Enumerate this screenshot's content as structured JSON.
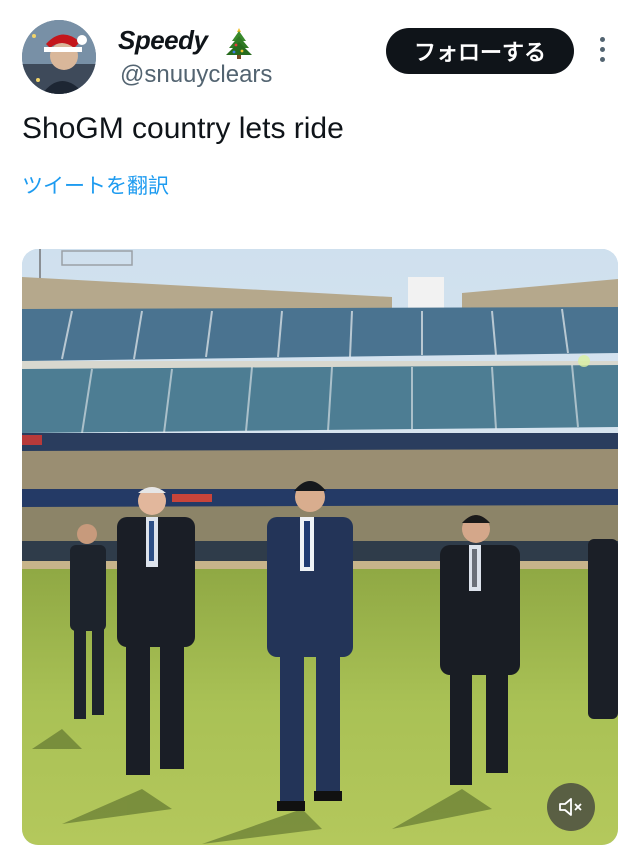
{
  "user": {
    "display_name": "Speedy",
    "display_name_emoji_icon": "christmas-tree-icon",
    "handle": "@snuuyclears",
    "avatar_icon": "user-avatar"
  },
  "actions": {
    "follow_label": "フォローする",
    "more_icon": "more-vertical-icon"
  },
  "tweet": {
    "text": "ShoGM country lets ride",
    "translate_label": "ツイートを翻訳"
  },
  "media": {
    "type": "video",
    "scene": "stadium-field-walk",
    "mute_icon": "speaker-muted-icon"
  },
  "colors": {
    "follow_bg": "#0f1419",
    "link": "#1d9bf0",
    "secondary_text": "#536471",
    "grass": "#9fb84f"
  }
}
